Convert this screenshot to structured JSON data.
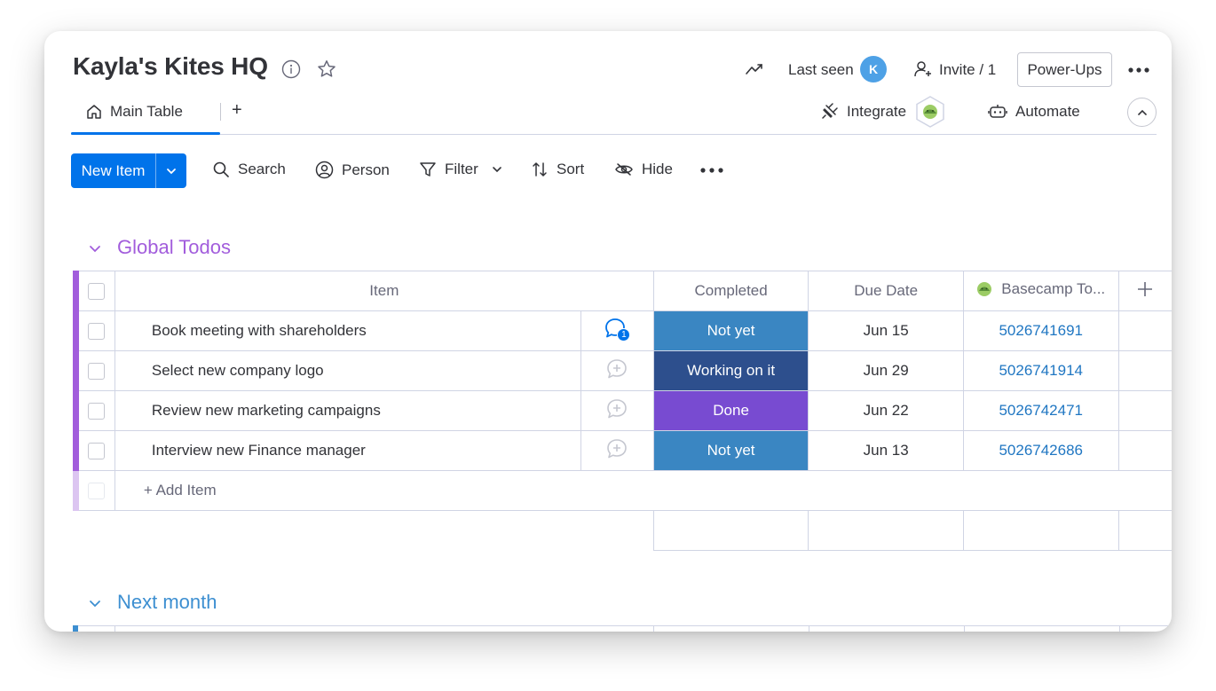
{
  "board": {
    "title": "Kayla's Kites HQ",
    "last_seen_label": "Last seen",
    "avatar_initial": "K",
    "invite_label": "Invite / 1",
    "powerups_label": "Power-Ups"
  },
  "tabs": {
    "main_table": "Main Table",
    "add": "+",
    "integrate": "Integrate",
    "automate": "Automate"
  },
  "toolbar": {
    "new_item": "New Item",
    "search": "Search",
    "person": "Person",
    "filter": "Filter",
    "sort": "Sort",
    "hide": "Hide"
  },
  "groups": [
    {
      "title": "Global Todos",
      "color": "#a25ddc",
      "columns": {
        "item": "Item",
        "completed": "Completed",
        "due_date": "Due Date",
        "basecamp": "Basecamp To..."
      },
      "rows": [
        {
          "name": "Book meeting with shareholders",
          "status": "Not yet",
          "status_color": "#3a86c2",
          "due": "Jun 15",
          "basecamp_id": "5026741691",
          "updates": "1"
        },
        {
          "name": "Select new company logo",
          "status": "Working on it",
          "status_color": "#2d4f8d",
          "due": "Jun 29",
          "basecamp_id": "5026741914",
          "updates": ""
        },
        {
          "name": "Review new marketing campaigns",
          "status": "Done",
          "status_color": "#784bd1",
          "due": "Jun 22",
          "basecamp_id": "5026742471",
          "updates": ""
        },
        {
          "name": "Interview new Finance manager",
          "status": "Not yet",
          "status_color": "#3a86c2",
          "due": "Jun 13",
          "basecamp_id": "5026742686",
          "updates": ""
        }
      ],
      "add_item_label": "+ Add Item"
    },
    {
      "title": "Next month",
      "color": "#3d8fd1"
    }
  ],
  "colors": {
    "primary": "#0073ea",
    "link": "#1f76c2",
    "border": "#d0d4e4"
  }
}
